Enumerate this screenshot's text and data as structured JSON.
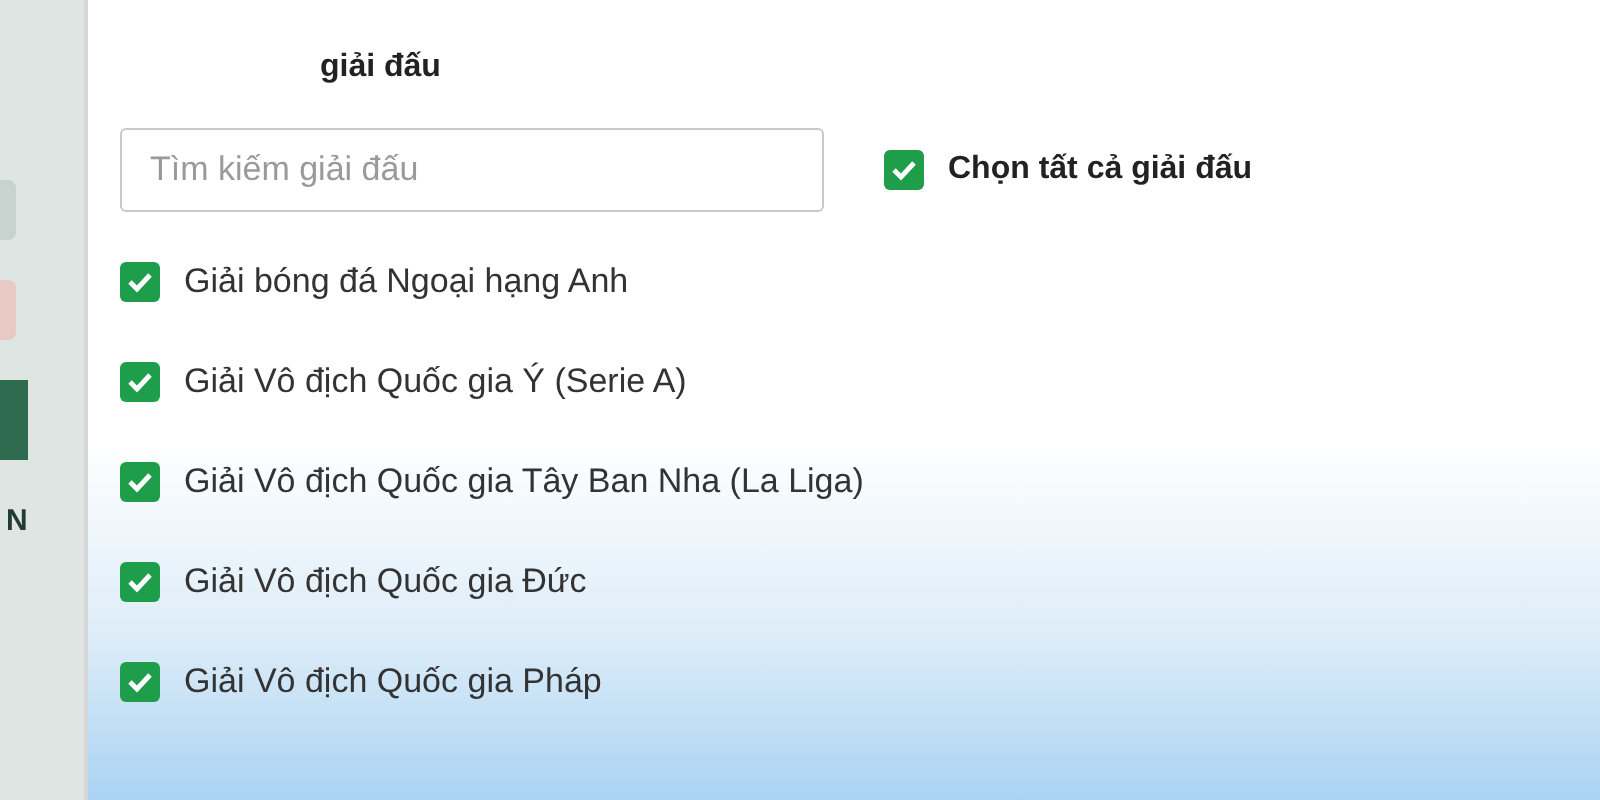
{
  "side_panel": {
    "letter": "N"
  },
  "panel": {
    "title": "giải đấu",
    "search": {
      "placeholder": "Tìm kiếm giải đấu"
    },
    "select_all": {
      "label": "Chọn tất cả giải đấu",
      "checked": true
    },
    "leagues": [
      {
        "label": "Giải bóng đá Ngoại hạng Anh",
        "checked": true
      },
      {
        "label": "Giải Vô địch Quốc gia Ý (Serie A)",
        "checked": true
      },
      {
        "label": "Giải Vô địch Quốc gia Tây Ban Nha (La Liga)",
        "checked": true
      },
      {
        "label": "Giải Vô địch Quốc gia Đức",
        "checked": true
      },
      {
        "label": "Giải Vô địch Quốc gia Pháp",
        "checked": true
      }
    ]
  }
}
